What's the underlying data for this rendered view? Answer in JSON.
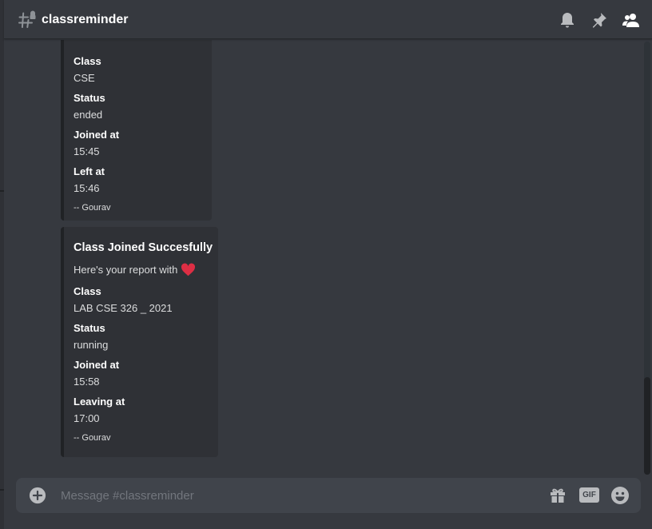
{
  "header": {
    "channel": "classreminder",
    "icons": [
      "threads-icon",
      "bell-icon",
      "pin-icon",
      "members-icon"
    ]
  },
  "messages": {
    "embed1": {
      "fields": [
        {
          "name": "Class",
          "value": "CSE"
        },
        {
          "name": "Status",
          "value": "ended"
        },
        {
          "name": "Joined at",
          "value": "15:45"
        },
        {
          "name": "Left at",
          "value": "15:46"
        }
      ],
      "footer": "-- Gourav"
    },
    "embed2": {
      "title": "Class Joined Succesfully",
      "description": "Here's your report with",
      "fields": [
        {
          "name": "Class",
          "value": "LAB CSE 326 _ 2021"
        },
        {
          "name": "Status",
          "value": "running"
        },
        {
          "name": "Joined at",
          "value": "15:58"
        },
        {
          "name": "Leaving at",
          "value": "17:00"
        }
      ],
      "footer": "-- Gourav"
    }
  },
  "composer": {
    "placeholder": "Message #classreminder",
    "value": "",
    "gif_label": "GIF"
  },
  "colors": {
    "background": "#36393f",
    "embed_bg": "#2f3136",
    "input_bg": "#40444b",
    "heart": "#dd2e44"
  }
}
